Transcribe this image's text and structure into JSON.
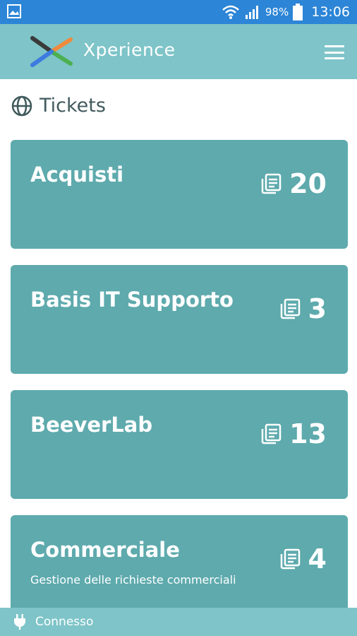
{
  "status_bar": {
    "battery_percent": "98%",
    "time": "13:06"
  },
  "app_bar": {
    "title": "Xperience"
  },
  "section": {
    "title": "Tickets"
  },
  "cards": [
    {
      "title": "Acquisti",
      "subtitle": "",
      "count": "20"
    },
    {
      "title": "Basis IT Supporto",
      "subtitle": "",
      "count": "3"
    },
    {
      "title": "BeeverLab",
      "subtitle": "",
      "count": "13"
    },
    {
      "title": "Commerciale",
      "subtitle": "Gestione delle richieste commerciali",
      "count": "4"
    }
  ],
  "footer": {
    "status": "Connesso"
  },
  "colors": {
    "status_bar": "#2c85d6",
    "app_bar": "#7ec4c8",
    "card": "#5eaaad",
    "section_title": "#415a5c"
  }
}
